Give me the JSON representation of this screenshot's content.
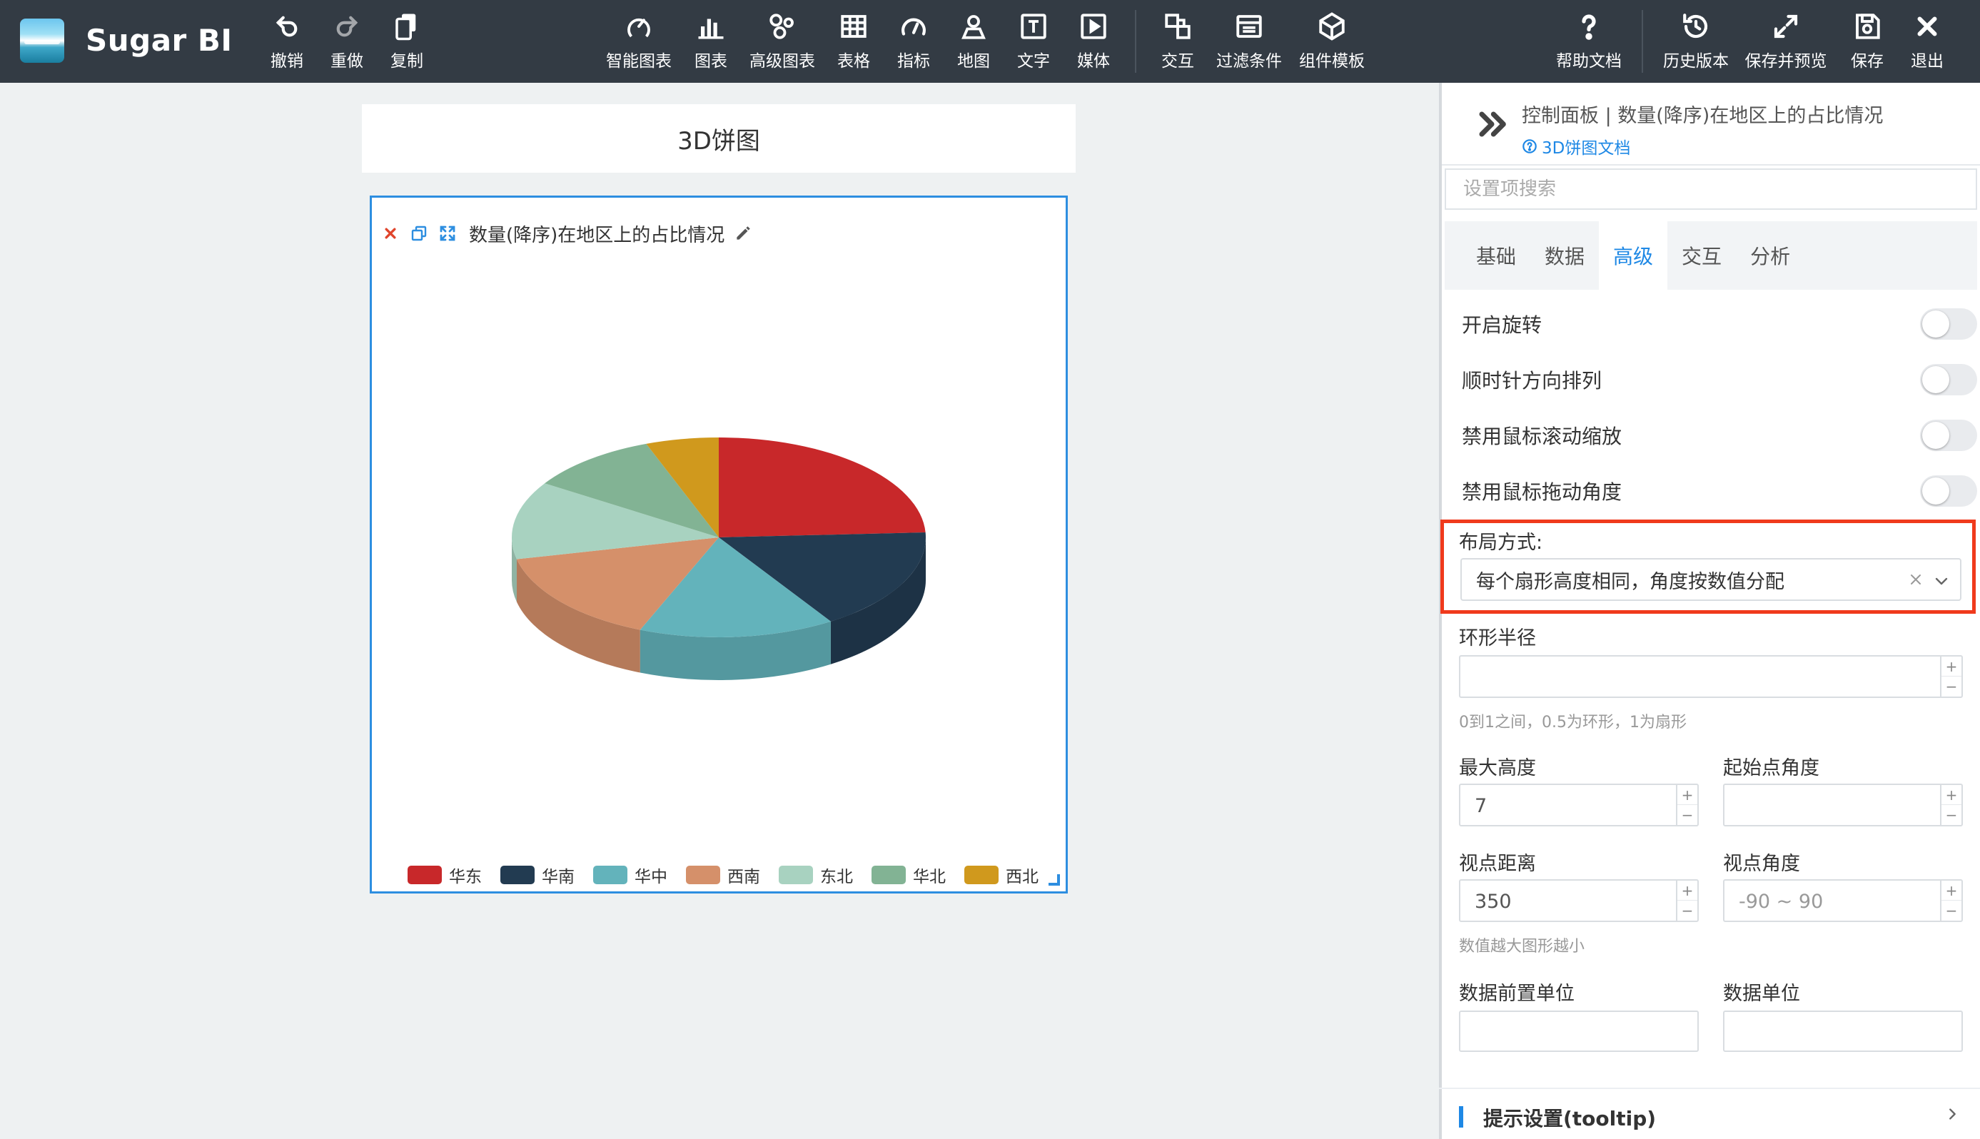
{
  "app": {
    "name": "Sugar BI"
  },
  "toolbar": {
    "left": [
      {
        "label": "撤销",
        "icon": "undo-icon"
      },
      {
        "label": "重做",
        "icon": "redo-icon"
      },
      {
        "label": "复制",
        "icon": "copy-icon"
      }
    ],
    "center": [
      {
        "label": "智能图表",
        "icon": "smart-chart-icon"
      },
      {
        "label": "图表",
        "icon": "bar-chart-icon"
      },
      {
        "label": "高级图表",
        "icon": "advanced-chart-icon"
      },
      {
        "label": "表格",
        "icon": "table-icon"
      },
      {
        "label": "指标",
        "icon": "gauge-icon"
      },
      {
        "label": "地图",
        "icon": "map-pin-icon"
      },
      {
        "label": "文字",
        "icon": "text-icon"
      },
      {
        "label": "媒体",
        "icon": "media-icon"
      },
      {
        "label": "交互",
        "icon": "interaction-icon"
      },
      {
        "label": "过滤条件",
        "icon": "filter-icon"
      },
      {
        "label": "组件模板",
        "icon": "template-icon"
      }
    ],
    "right": [
      {
        "label": "帮助文档",
        "icon": "help-icon"
      },
      {
        "label": "历史版本",
        "icon": "history-icon"
      },
      {
        "label": "保存并预览",
        "icon": "expand-icon"
      },
      {
        "label": "保存",
        "icon": "save-icon"
      },
      {
        "label": "退出",
        "icon": "close-icon"
      }
    ]
  },
  "canvas": {
    "title": "3D饼图",
    "widget_title": "数量(降序)在地区上的占比情况"
  },
  "chart_data": {
    "type": "pie",
    "variant": "3d",
    "categories": [
      "华东",
      "华南",
      "华中",
      "西南",
      "东北",
      "华北",
      "西北"
    ],
    "colors": [
      "#c8282a",
      "#223b51",
      "#63b3bb",
      "#d5906a",
      "#a8d2c0",
      "#82b394",
      "#d0991d"
    ],
    "values": [
      24.2,
      16.7,
      15.3,
      15.3,
      12.6,
      10.2,
      5.7
    ],
    "legend_position": "bottom"
  },
  "panel": {
    "title": "控制面板 | 数量(降序)在地区上的占比情况",
    "doc_link": "3D饼图文档",
    "search_placeholder": "设置项搜索",
    "tabs": [
      "基础",
      "数据",
      "高级",
      "交互",
      "分析"
    ],
    "active_tab": "高级",
    "toggles": [
      {
        "label": "开启旋转",
        "on": false
      },
      {
        "label": "顺时针方向排列",
        "on": false
      },
      {
        "label": "禁用鼠标滚动缩放",
        "on": false
      },
      {
        "label": "禁用鼠标拖动角度",
        "on": false
      }
    ],
    "layout_label": "布局方式:",
    "layout_value": "每个扇形高度相同，角度按数值分配",
    "ring_radius_label": "环形半径",
    "ring_radius_hint": "0到1之间，0.5为环形，1为扇形",
    "max_height_label": "最大高度",
    "max_height_value": "7",
    "start_angle_label": "起始点角度",
    "view_distance_label": "视点距离",
    "view_distance_value": "350",
    "view_angle_label": "视点角度",
    "view_angle_placeholder": "-90 ~ 90",
    "view_hint": "数值越大图形越小",
    "prefix_unit_label": "数据前置单位",
    "unit_label": "数据单位",
    "section_tooltip": "提示设置(tooltip)"
  }
}
